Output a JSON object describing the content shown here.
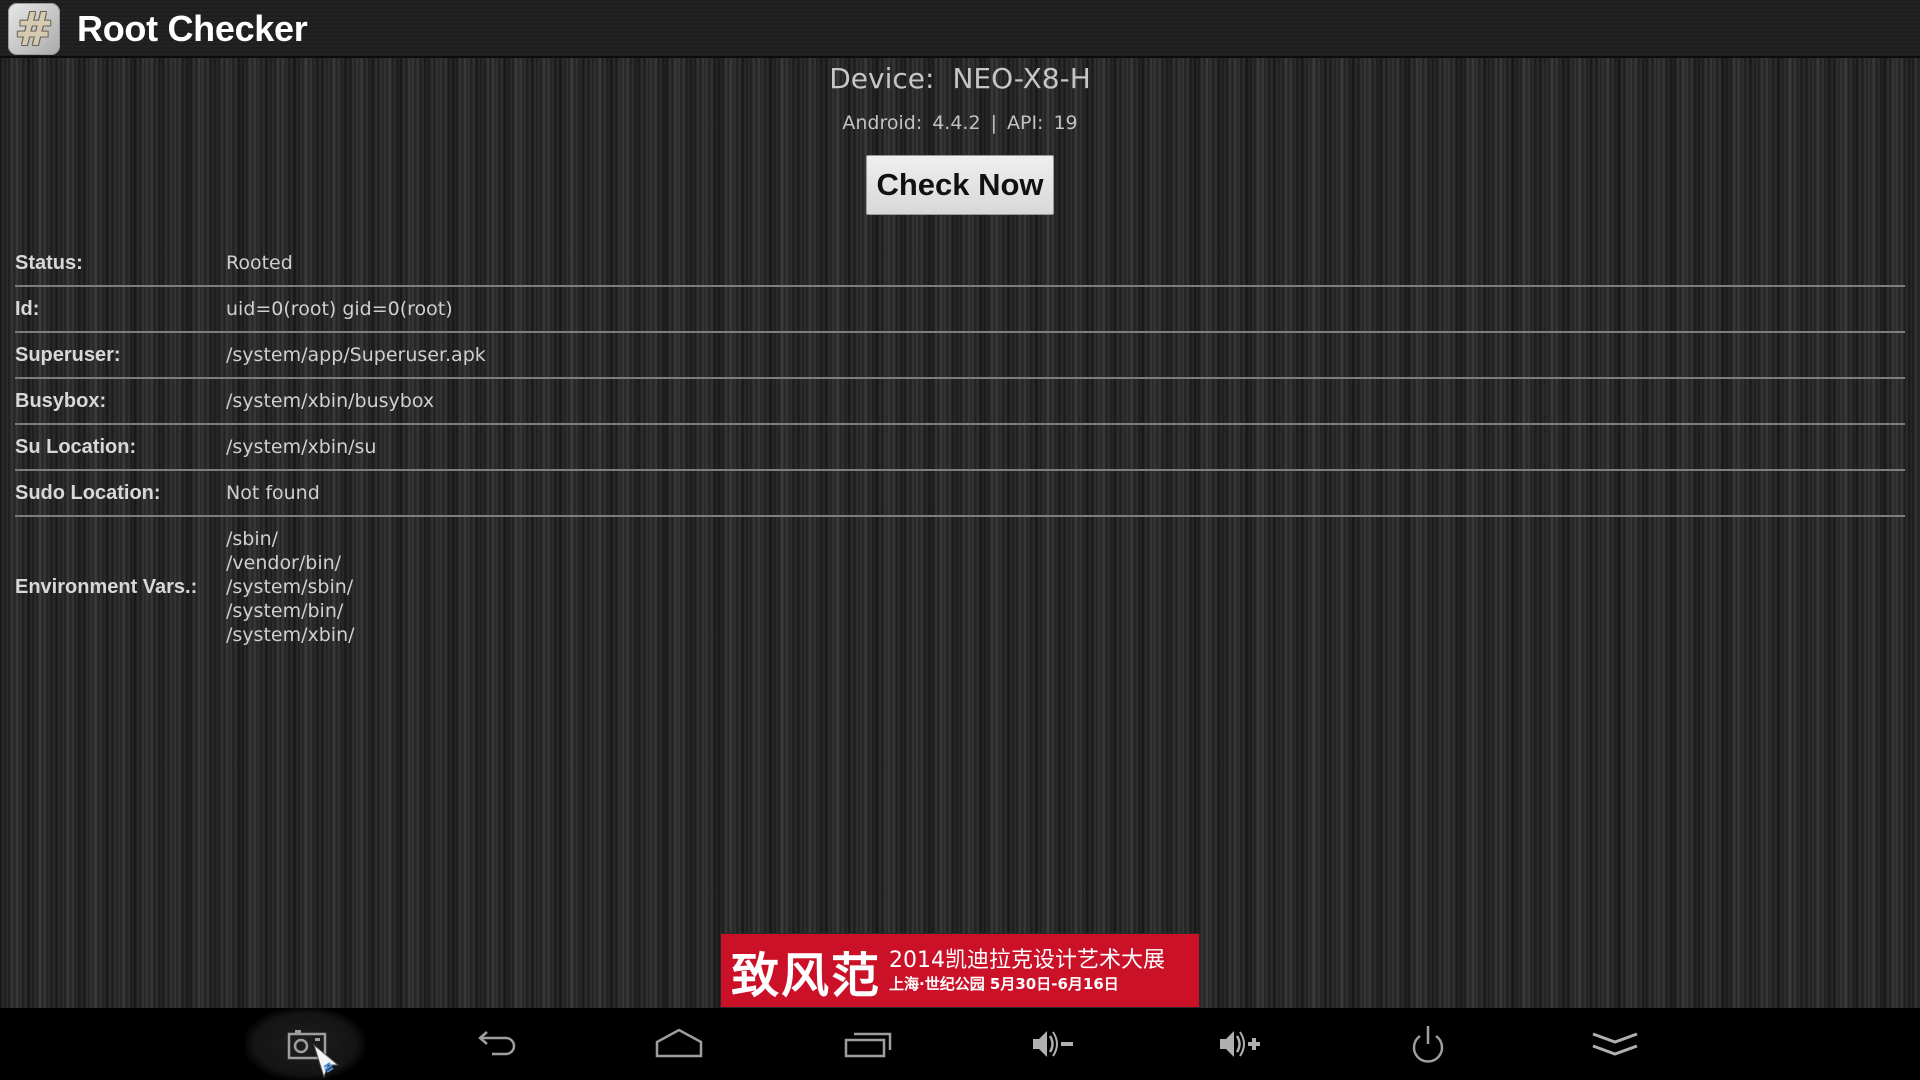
{
  "app": {
    "title": "Root Checker",
    "icon": "hash-icon",
    "icon_glyph": "#"
  },
  "device": {
    "label": "Device:",
    "name": "NEO-X8-H",
    "android_label": "Android:",
    "android_version": "4.4.2",
    "separator": "|",
    "api_label": "API:",
    "api_level": "19"
  },
  "check_button": {
    "label": "Check Now"
  },
  "info_rows": [
    {
      "label": "Status:",
      "value": "Rooted"
    },
    {
      "label": "Id:",
      "value": "uid=0(root) gid=0(root)"
    },
    {
      "label": "Superuser:",
      "value": "/system/app/Superuser.apk"
    },
    {
      "label": "Busybox:",
      "value": "/system/xbin/busybox"
    },
    {
      "label": "Su Location:",
      "value": "/system/xbin/su"
    },
    {
      "label": "Sudo Location:",
      "value": "Not found"
    }
  ],
  "environment": {
    "label": "Environment Vars.:",
    "values": [
      "/sbin/",
      "/vendor/bin/",
      "/system/sbin/",
      "/system/bin/",
      "/system/xbin/"
    ]
  },
  "ad": {
    "headline": "致风范",
    "line1": "2014凯迪拉克设计艺术大展",
    "line2": "上海·世纪公园  5月30日-6月16日",
    "color": "#cb1128"
  },
  "nav_bar": {
    "buttons": [
      {
        "name": "screenshot",
        "icon": "camera-icon"
      },
      {
        "name": "back",
        "icon": "back-arrow-icon"
      },
      {
        "name": "home",
        "icon": "home-icon"
      },
      {
        "name": "recents",
        "icon": "recent-apps-icon"
      },
      {
        "name": "volume-down",
        "icon": "volume-down-icon"
      },
      {
        "name": "volume-up",
        "icon": "volume-up-icon"
      },
      {
        "name": "power",
        "icon": "power-icon"
      },
      {
        "name": "hide-bar",
        "icon": "double-chevron-down-icon"
      }
    ]
  }
}
